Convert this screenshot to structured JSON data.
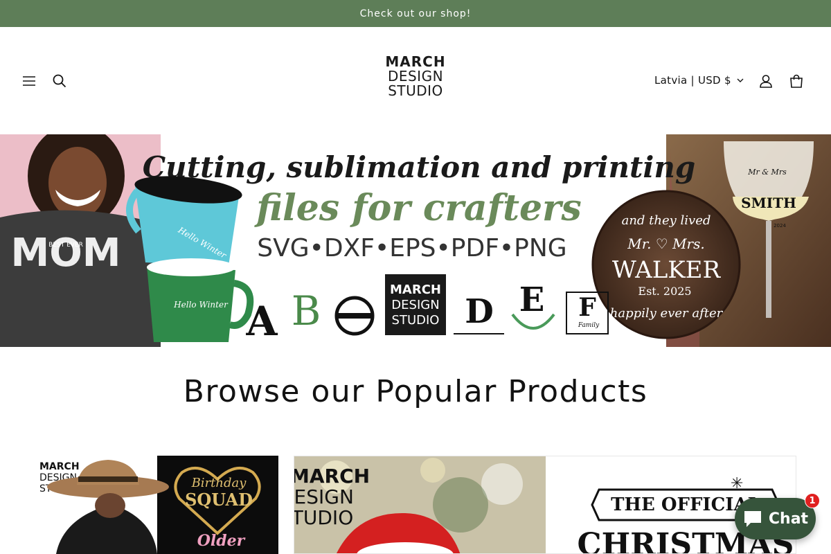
{
  "announcement": "Check out our shop!",
  "logo": {
    "line1": "MARCH",
    "line2": "DESIGN",
    "line3": "STUDIO"
  },
  "header": {
    "locale": "Latvia | USD $"
  },
  "hero": {
    "headline": "Cutting, sublimation and printing",
    "subhead": "files for crafters",
    "formats": "SVG•DXF•EPS•PDF•PNG",
    "shirt_text": "MOM",
    "shirt_small": "BEST EVER",
    "mug_text": "Hello Winter",
    "letters": [
      "A",
      "B",
      "D",
      "E",
      "F"
    ],
    "family_text": "Family",
    "badge": {
      "line1": "MARCH",
      "line2": "DESIGN",
      "line3": "STUDIO"
    },
    "plaque": {
      "top": "and they lived",
      "names": "Mr. ♡ Mrs.",
      "surname": "WALKER",
      "est": "Est. 2025",
      "bottom": "happily ever after"
    },
    "glass": {
      "small": "Mr & Mrs",
      "name": "SMITH",
      "est": "2024"
    }
  },
  "section": {
    "title": "Browse our Popular Products"
  },
  "products": [
    {
      "brand1": "MARCH",
      "brand2": "DESIGN",
      "brand3": "STUDIO",
      "script": "Birthday",
      "big": "SQUAD",
      "older": "Older"
    },
    {
      "brand1": "MARCH",
      "brand2": "DESIGN",
      "brand3": "STUDIO",
      "banner": "THE OFFICIAL",
      "big": "CHRISTMAS"
    }
  ],
  "chat": {
    "label": "Chat",
    "badge": "1"
  },
  "colors": {
    "announcement_bg": "#5e7e58",
    "chat_bg": "#36543b",
    "accent_green": "#6a8a5a"
  }
}
